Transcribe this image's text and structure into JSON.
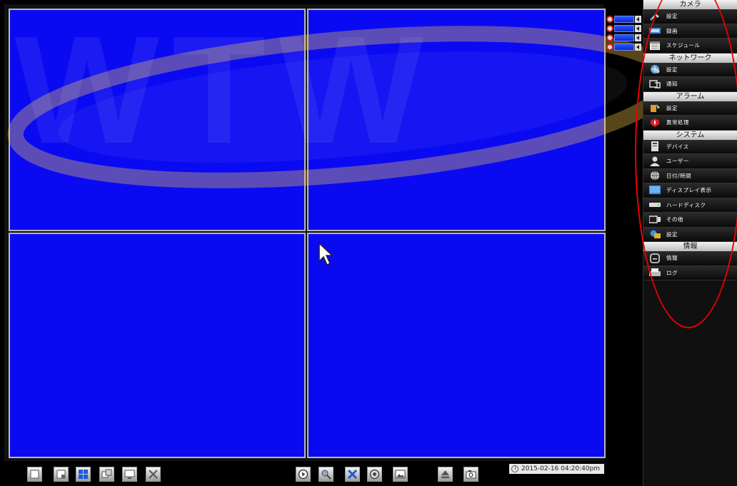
{
  "camera_menu": {
    "sections": [
      {
        "title": "カメラ",
        "items": [
          {
            "label": "設定",
            "icon": "camera-settings-icon"
          },
          {
            "label": "録画",
            "icon": "record-icon"
          },
          {
            "label": "スケジュール",
            "icon": "calendar-icon"
          }
        ]
      },
      {
        "title": "ネットワーク",
        "items": [
          {
            "label": "設定",
            "icon": "network-settings-icon"
          },
          {
            "label": "通知",
            "icon": "notification-icon"
          }
        ]
      },
      {
        "title": "アラーム",
        "items": [
          {
            "label": "設定",
            "icon": "alarm-settings-icon"
          },
          {
            "label": "異常処理",
            "icon": "exception-icon"
          }
        ]
      },
      {
        "title": "システム",
        "items": [
          {
            "label": "デバイス",
            "icon": "device-icon"
          },
          {
            "label": "ユーザー",
            "icon": "user-icon"
          },
          {
            "label": "日付/時間",
            "icon": "globe-clock-icon"
          },
          {
            "label": "ディスプレイ表示",
            "icon": "display-icon"
          },
          {
            "label": "ハードディスク",
            "icon": "hard-disk-icon"
          },
          {
            "label": "その他",
            "icon": "other-icon"
          },
          {
            "label": "設定",
            "icon": "system-settings-icon"
          }
        ]
      },
      {
        "title": "情報",
        "items": [
          {
            "label": "情報",
            "icon": "info-icon"
          },
          {
            "label": "ログ",
            "icon": "log-icon"
          }
        ]
      }
    ]
  },
  "toolbar": {
    "datetime": "2015-02-16 04:20:40pm"
  },
  "watermark": {
    "text": "WTW"
  },
  "colors": {
    "channel_bg": "#0a0af2",
    "highlight": "#e00000",
    "watermark_yellow": "#f6c94a"
  }
}
